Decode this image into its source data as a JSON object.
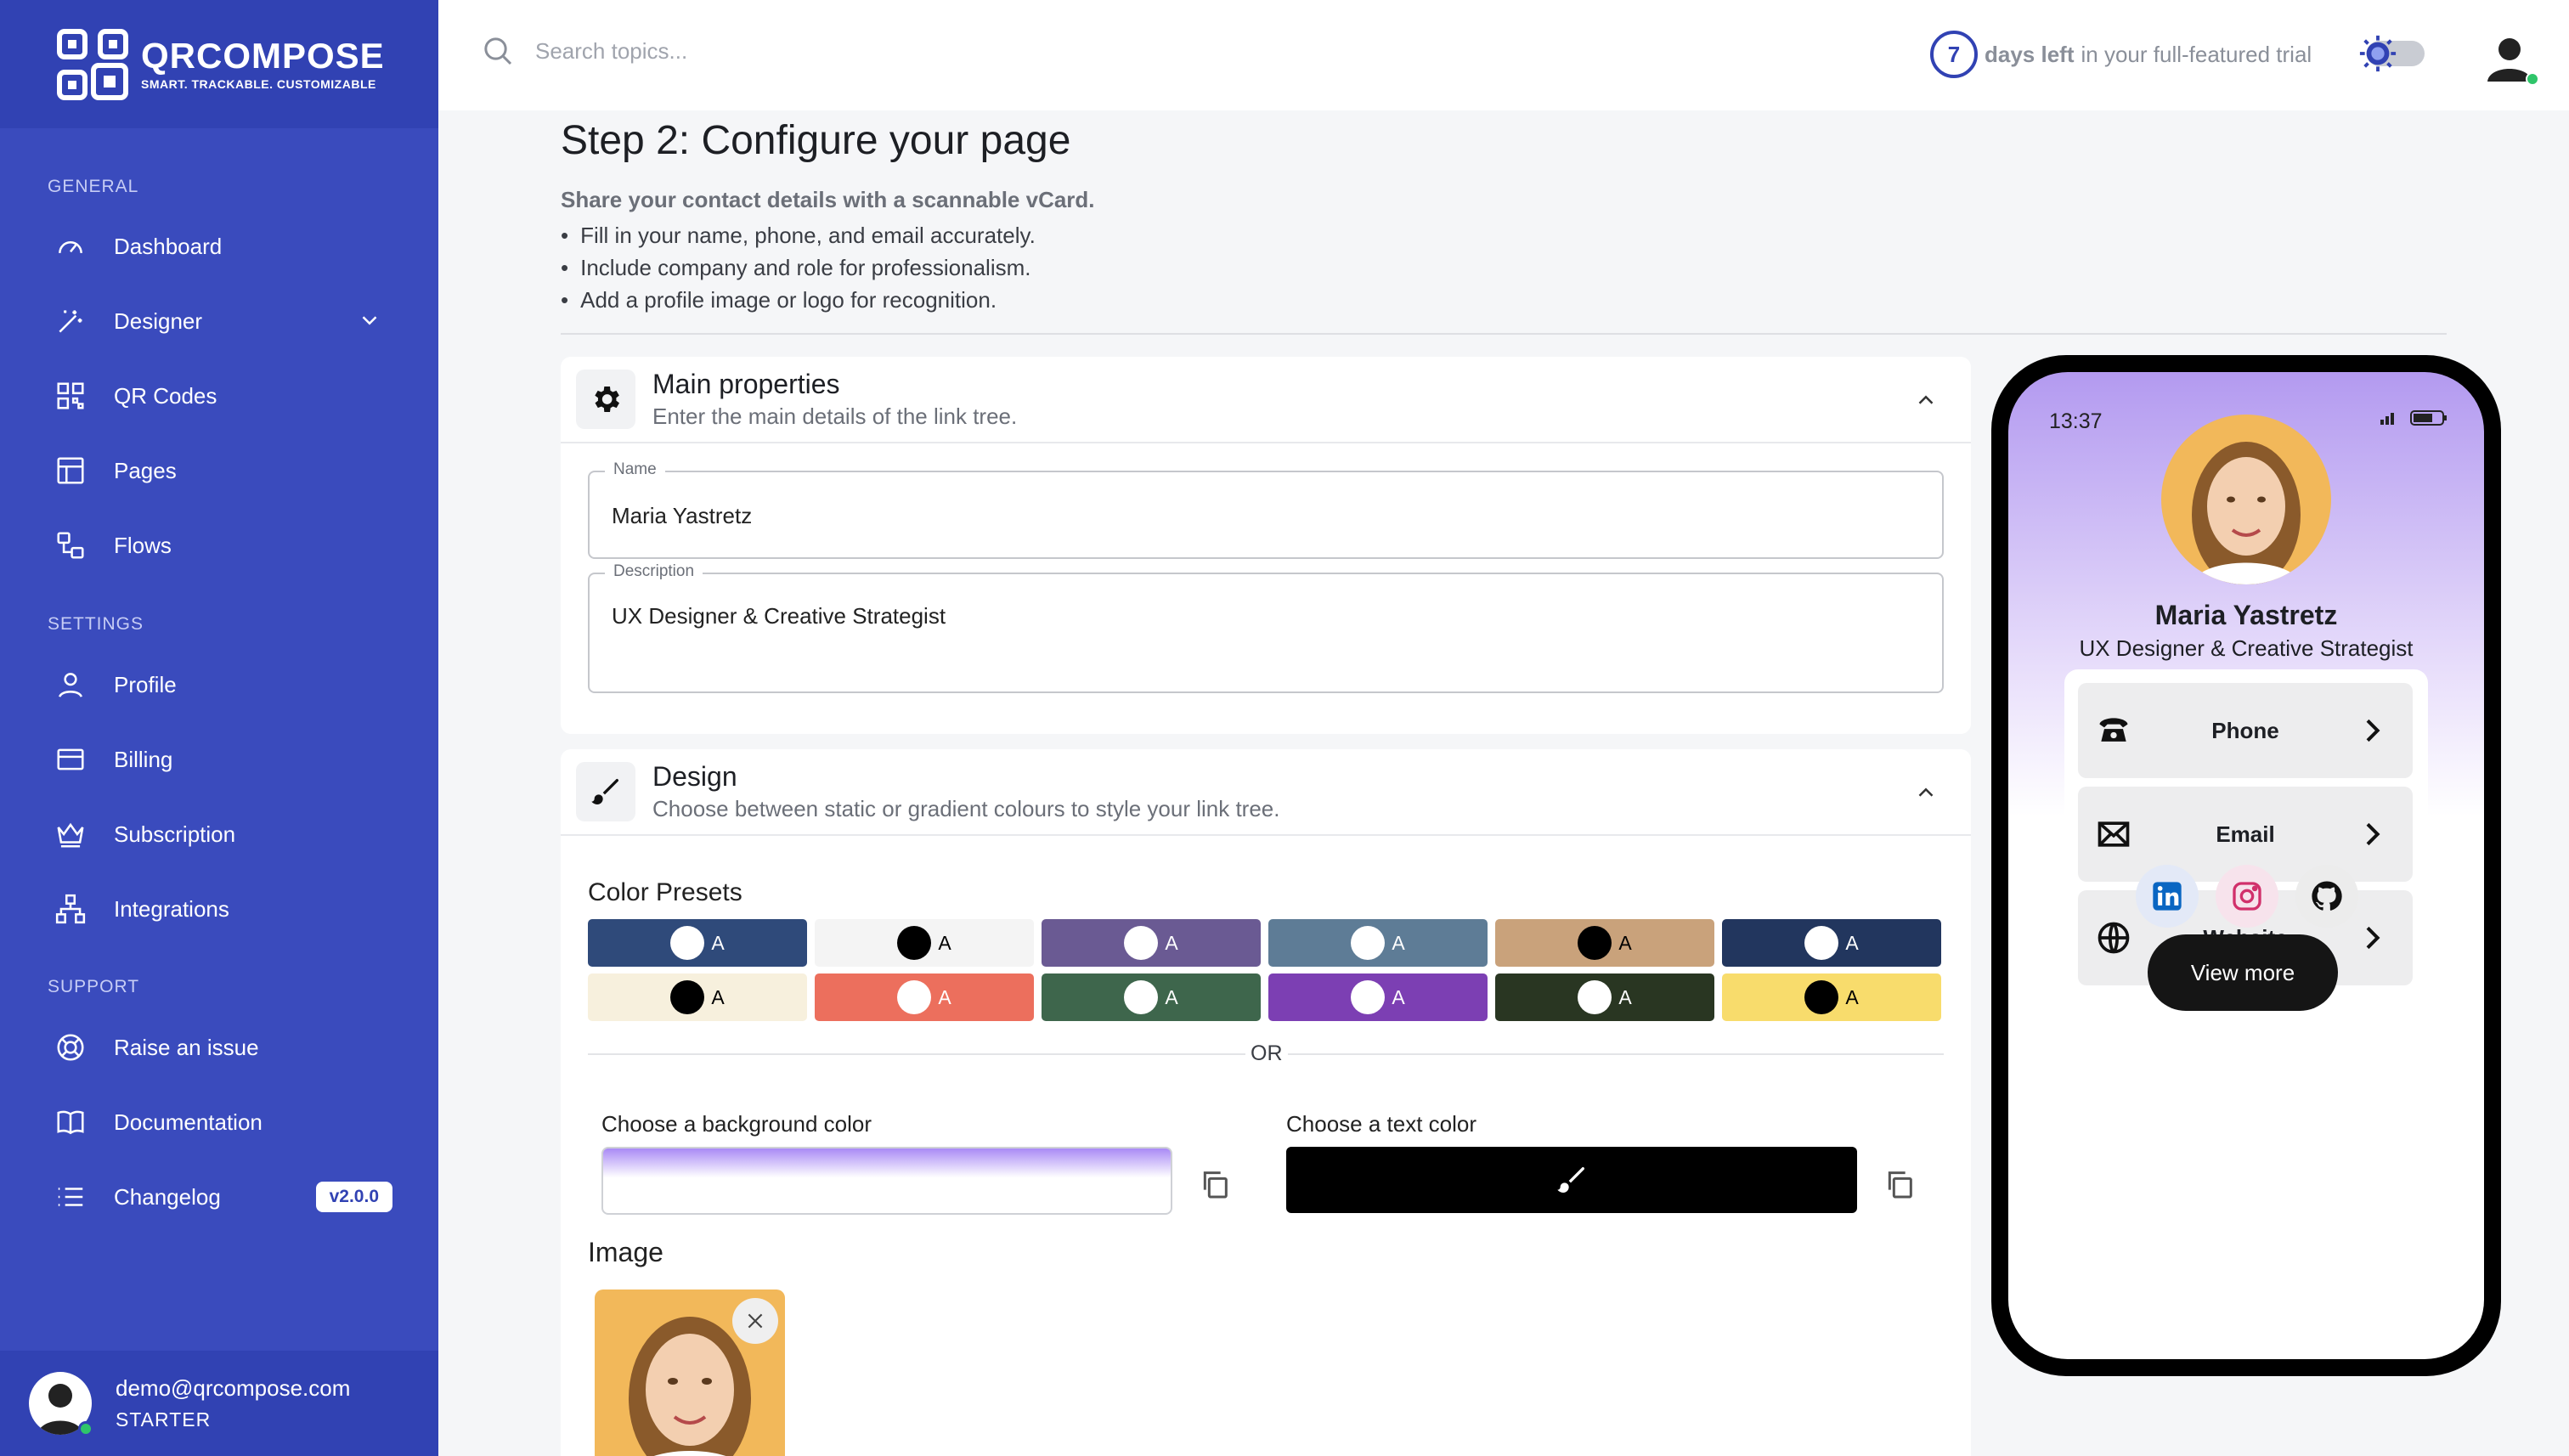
{
  "brand": {
    "name": "QRCOMPOSE",
    "tagline": "SMART. TRACKABLE. CUSTOMIZABLE"
  },
  "sidebar": {
    "sections": [
      "GENERAL",
      "SETTINGS",
      "SUPPORT"
    ],
    "items": [
      {
        "label": "Dashboard",
        "icon": "gauge-icon"
      },
      {
        "label": "Designer",
        "icon": "magic-wand-icon"
      },
      {
        "label": "QR Codes",
        "icon": "qr-icon"
      },
      {
        "label": "Pages",
        "icon": "layout-icon"
      },
      {
        "label": "Flows",
        "icon": "flow-icon"
      },
      {
        "label": "Profile",
        "icon": "user-icon"
      },
      {
        "label": "Billing",
        "icon": "card-icon"
      },
      {
        "label": "Subscription",
        "icon": "crown-icon"
      },
      {
        "label": "Integrations",
        "icon": "network-icon"
      },
      {
        "label": "Raise an issue",
        "icon": "lifebuoy-icon"
      },
      {
        "label": "Documentation",
        "icon": "book-icon"
      },
      {
        "label": "Changelog",
        "icon": "list-icon"
      }
    ],
    "version": "v2.0.0",
    "user": {
      "email": "demo@qrcompose.com",
      "plan": "STARTER"
    }
  },
  "topbar": {
    "search_placeholder": "Search topics...",
    "trial_days": "7",
    "trial_bold": "days left",
    "trial_rest": "in your full-featured trial"
  },
  "page": {
    "title": "Step 2: Configure your page",
    "subtitle": "Share your contact details with a scannable vCard.",
    "bullets": [
      "Fill in your name, phone, and email accurately.",
      "Include company and role for professionalism.",
      "Add a profile image or logo for recognition."
    ]
  },
  "main_props": {
    "title": "Main properties",
    "desc": "Enter the main details of the link tree.",
    "name_label": "Name",
    "name_value": "Maria Yastretz",
    "desc_label": "Description",
    "desc_value": "UX Designer & Creative Strategist"
  },
  "design": {
    "title": "Design",
    "desc": "Choose between static or gradient colours to style your link tree.",
    "presets_title": "Color Presets",
    "presets": [
      {
        "bg": "#2f4a7a",
        "dot": "#ffffff",
        "text": "#ffffff"
      },
      {
        "bg": "#f4f4f4",
        "dot": "#000000",
        "text": "#000000"
      },
      {
        "bg": "#6a5a93",
        "dot": "#ffffff",
        "text": "#ffffff"
      },
      {
        "bg": "#5e7c96",
        "dot": "#ffffff",
        "text": "#ffffff"
      },
      {
        "bg": "#c9a27b",
        "dot": "#000000",
        "text": "#000000"
      },
      {
        "bg": "#22365e",
        "dot": "#ffffff",
        "text": "#ffffff"
      },
      {
        "bg": "#f7f0dd",
        "dot": "#000000",
        "text": "#000000"
      },
      {
        "bg": "#ec6f5d",
        "dot": "#ffffff",
        "text": "#ffffff"
      },
      {
        "bg": "#3e664c",
        "dot": "#ffffff",
        "text": "#ffffff"
      },
      {
        "bg": "#7c3fb3",
        "dot": "#ffffff",
        "text": "#ffffff"
      },
      {
        "bg": "#293622",
        "dot": "#ffffff",
        "text": "#ffffff"
      },
      {
        "bg": "#f8dc6c",
        "dot": "#000000",
        "text": "#000000"
      }
    ],
    "preset_letter": "A",
    "or_text": "OR",
    "bg_label": "Choose a background color",
    "text_label": "Choose a text color",
    "image_title": "Image"
  },
  "preview": {
    "time": "13:37",
    "name": "Maria Yastretz",
    "desc": "UX Designer & Creative Strategist",
    "links": [
      "Phone",
      "Email",
      "Website"
    ],
    "view_more": "View more"
  }
}
